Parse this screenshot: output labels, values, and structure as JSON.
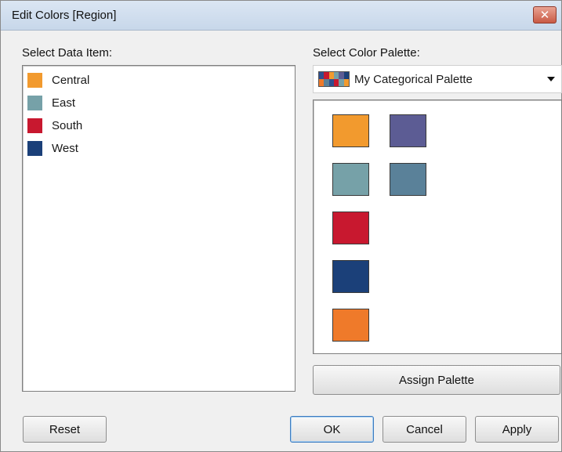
{
  "window": {
    "title": "Edit Colors [Region]",
    "close_glyph": "✕"
  },
  "left": {
    "label": "Select Data Item:",
    "items": [
      {
        "label": "Central",
        "color": "#f29a2e"
      },
      {
        "label": "East",
        "color": "#76a1a8"
      },
      {
        "label": "South",
        "color": "#c8182f"
      },
      {
        "label": "West",
        "color": "#1b4079"
      }
    ]
  },
  "right": {
    "label": "Select Color Palette:",
    "palette_name": "My Categorical Palette",
    "palette_icon": "palette-preview-icon",
    "dropdown_icon": "chevron-down-icon",
    "swatches": [
      {
        "color": "#f29a2e"
      },
      {
        "color": "#5c5c94"
      },
      {
        "color": "#76a1a8"
      },
      {
        "color": "#5a8199"
      },
      {
        "color": "#c8182f"
      },
      {
        "color": "#1b4079"
      },
      {
        "color": "#ef7a2a"
      }
    ],
    "assign_label": "Assign Palette"
  },
  "buttons": {
    "reset": "Reset",
    "ok": "OK",
    "cancel": "Cancel",
    "apply": "Apply"
  }
}
